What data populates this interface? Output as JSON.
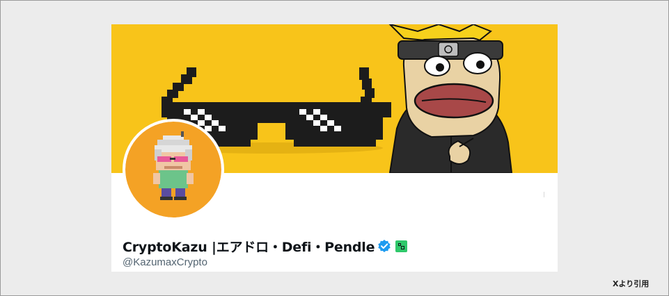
{
  "profile": {
    "display_name": "CryptoKazu |エアドロ・Defi・Pendle",
    "handle": "@KazumaxCrypto",
    "verified": true
  },
  "banner": {
    "background_color": "#f8c41a",
    "subjects": [
      "pixel-sunglasses",
      "cartoon-character"
    ]
  },
  "avatar": {
    "background_color": "#f4a225",
    "subject": "pixel-art-character"
  },
  "source": {
    "label": "Xより引用"
  },
  "colors": {
    "verified_badge": "#1d9bf0",
    "affiliate_badge": "#2fc86a",
    "name_text": "#0f1419",
    "handle_text": "#536471"
  }
}
